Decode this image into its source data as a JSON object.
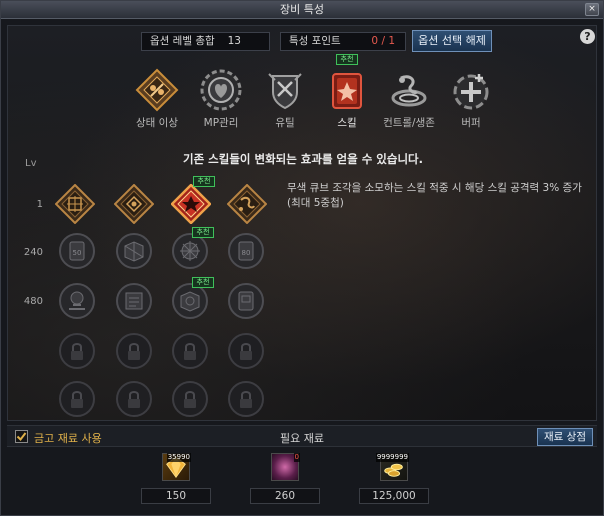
{
  "window": {
    "title": "장비 특성",
    "close_label": "×"
  },
  "header": {
    "option_level_label": "옵션 레벨 총합",
    "option_level_value": "13",
    "trait_points_label": "특성 포인트",
    "trait_points_value": "0 / 1",
    "reset_button": "옵션 선택 해제",
    "help_label": "?"
  },
  "categories": [
    {
      "label": "상태 이상",
      "icon": "status-effect-icon"
    },
    {
      "label": "MP관리",
      "icon": "mp-management-icon"
    },
    {
      "label": "유틸",
      "icon": "utility-icon"
    },
    {
      "label": "스킬",
      "icon": "skill-icon",
      "active": true,
      "badge": "추천"
    },
    {
      "label": "컨트롤/생존",
      "icon": "control-survival-icon"
    },
    {
      "label": "버퍼",
      "icon": "buffer-icon"
    }
  ],
  "description": "기존 스킬들이 변화되는 효과를 얻을 수 있습니다.",
  "levels": {
    "header": "Lv",
    "rows": [
      "1",
      "240",
      "480"
    ]
  },
  "recommend_badge": "추천",
  "skill_detail": "무색 큐브 조각을 소모하는 스킬 적중 시 해당 스킬 공격력 3% 증가 (최대 5중첩)",
  "bottom": {
    "storage_checkbox_label": "금고 재료 사용",
    "storage_checked": true,
    "materials_title": "필요 재료",
    "store_button": "재료 상점"
  },
  "materials": [
    {
      "icon": "gold-crystal-icon",
      "owned": "35990",
      "required": "150"
    },
    {
      "icon": "pink-orb-icon",
      "owned": "0",
      "required": "260",
      "insufficient": true
    },
    {
      "icon": "gold-coins-icon",
      "owned": "9999999",
      "required": "125,000"
    }
  ],
  "colors": {
    "accent_gold": "#c98d3a",
    "active_red": "#d63a2a",
    "badge_green": "#3fc05a"
  }
}
